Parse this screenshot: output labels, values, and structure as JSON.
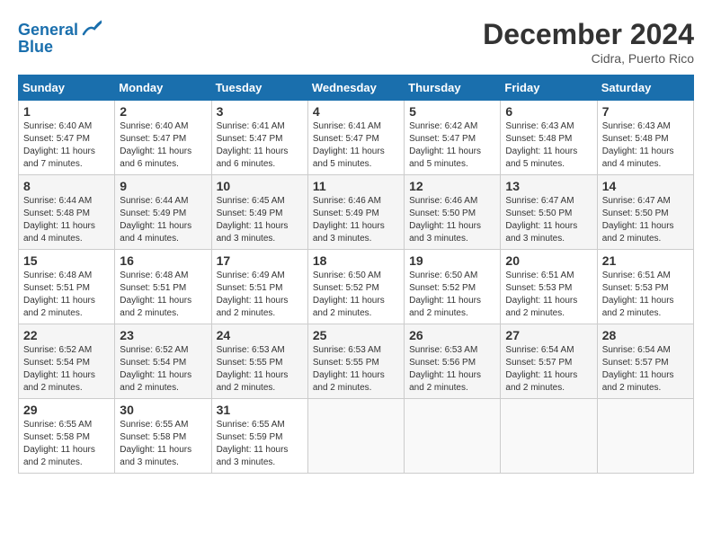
{
  "header": {
    "logo_line1": "General",
    "logo_line2": "Blue",
    "month": "December 2024",
    "location": "Cidra, Puerto Rico"
  },
  "days_of_week": [
    "Sunday",
    "Monday",
    "Tuesday",
    "Wednesday",
    "Thursday",
    "Friday",
    "Saturday"
  ],
  "weeks": [
    [
      {
        "day": "1",
        "sunrise": "Sunrise: 6:40 AM",
        "sunset": "Sunset: 5:47 PM",
        "daylight": "Daylight: 11 hours and 7 minutes."
      },
      {
        "day": "2",
        "sunrise": "Sunrise: 6:40 AM",
        "sunset": "Sunset: 5:47 PM",
        "daylight": "Daylight: 11 hours and 6 minutes."
      },
      {
        "day": "3",
        "sunrise": "Sunrise: 6:41 AM",
        "sunset": "Sunset: 5:47 PM",
        "daylight": "Daylight: 11 hours and 6 minutes."
      },
      {
        "day": "4",
        "sunrise": "Sunrise: 6:41 AM",
        "sunset": "Sunset: 5:47 PM",
        "daylight": "Daylight: 11 hours and 5 minutes."
      },
      {
        "day": "5",
        "sunrise": "Sunrise: 6:42 AM",
        "sunset": "Sunset: 5:47 PM",
        "daylight": "Daylight: 11 hours and 5 minutes."
      },
      {
        "day": "6",
        "sunrise": "Sunrise: 6:43 AM",
        "sunset": "Sunset: 5:48 PM",
        "daylight": "Daylight: 11 hours and 5 minutes."
      },
      {
        "day": "7",
        "sunrise": "Sunrise: 6:43 AM",
        "sunset": "Sunset: 5:48 PM",
        "daylight": "Daylight: 11 hours and 4 minutes."
      }
    ],
    [
      {
        "day": "8",
        "sunrise": "Sunrise: 6:44 AM",
        "sunset": "Sunset: 5:48 PM",
        "daylight": "Daylight: 11 hours and 4 minutes."
      },
      {
        "day": "9",
        "sunrise": "Sunrise: 6:44 AM",
        "sunset": "Sunset: 5:49 PM",
        "daylight": "Daylight: 11 hours and 4 minutes."
      },
      {
        "day": "10",
        "sunrise": "Sunrise: 6:45 AM",
        "sunset": "Sunset: 5:49 PM",
        "daylight": "Daylight: 11 hours and 3 minutes."
      },
      {
        "day": "11",
        "sunrise": "Sunrise: 6:46 AM",
        "sunset": "Sunset: 5:49 PM",
        "daylight": "Daylight: 11 hours and 3 minutes."
      },
      {
        "day": "12",
        "sunrise": "Sunrise: 6:46 AM",
        "sunset": "Sunset: 5:50 PM",
        "daylight": "Daylight: 11 hours and 3 minutes."
      },
      {
        "day": "13",
        "sunrise": "Sunrise: 6:47 AM",
        "sunset": "Sunset: 5:50 PM",
        "daylight": "Daylight: 11 hours and 3 minutes."
      },
      {
        "day": "14",
        "sunrise": "Sunrise: 6:47 AM",
        "sunset": "Sunset: 5:50 PM",
        "daylight": "Daylight: 11 hours and 2 minutes."
      }
    ],
    [
      {
        "day": "15",
        "sunrise": "Sunrise: 6:48 AM",
        "sunset": "Sunset: 5:51 PM",
        "daylight": "Daylight: 11 hours and 2 minutes."
      },
      {
        "day": "16",
        "sunrise": "Sunrise: 6:48 AM",
        "sunset": "Sunset: 5:51 PM",
        "daylight": "Daylight: 11 hours and 2 minutes."
      },
      {
        "day": "17",
        "sunrise": "Sunrise: 6:49 AM",
        "sunset": "Sunset: 5:51 PM",
        "daylight": "Daylight: 11 hours and 2 minutes."
      },
      {
        "day": "18",
        "sunrise": "Sunrise: 6:50 AM",
        "sunset": "Sunset: 5:52 PM",
        "daylight": "Daylight: 11 hours and 2 minutes."
      },
      {
        "day": "19",
        "sunrise": "Sunrise: 6:50 AM",
        "sunset": "Sunset: 5:52 PM",
        "daylight": "Daylight: 11 hours and 2 minutes."
      },
      {
        "day": "20",
        "sunrise": "Sunrise: 6:51 AM",
        "sunset": "Sunset: 5:53 PM",
        "daylight": "Daylight: 11 hours and 2 minutes."
      },
      {
        "day": "21",
        "sunrise": "Sunrise: 6:51 AM",
        "sunset": "Sunset: 5:53 PM",
        "daylight": "Daylight: 11 hours and 2 minutes."
      }
    ],
    [
      {
        "day": "22",
        "sunrise": "Sunrise: 6:52 AM",
        "sunset": "Sunset: 5:54 PM",
        "daylight": "Daylight: 11 hours and 2 minutes."
      },
      {
        "day": "23",
        "sunrise": "Sunrise: 6:52 AM",
        "sunset": "Sunset: 5:54 PM",
        "daylight": "Daylight: 11 hours and 2 minutes."
      },
      {
        "day": "24",
        "sunrise": "Sunrise: 6:53 AM",
        "sunset": "Sunset: 5:55 PM",
        "daylight": "Daylight: 11 hours and 2 minutes."
      },
      {
        "day": "25",
        "sunrise": "Sunrise: 6:53 AM",
        "sunset": "Sunset: 5:55 PM",
        "daylight": "Daylight: 11 hours and 2 minutes."
      },
      {
        "day": "26",
        "sunrise": "Sunrise: 6:53 AM",
        "sunset": "Sunset: 5:56 PM",
        "daylight": "Daylight: 11 hours and 2 minutes."
      },
      {
        "day": "27",
        "sunrise": "Sunrise: 6:54 AM",
        "sunset": "Sunset: 5:57 PM",
        "daylight": "Daylight: 11 hours and 2 minutes."
      },
      {
        "day": "28",
        "sunrise": "Sunrise: 6:54 AM",
        "sunset": "Sunset: 5:57 PM",
        "daylight": "Daylight: 11 hours and 2 minutes."
      }
    ],
    [
      {
        "day": "29",
        "sunrise": "Sunrise: 6:55 AM",
        "sunset": "Sunset: 5:58 PM",
        "daylight": "Daylight: 11 hours and 2 minutes."
      },
      {
        "day": "30",
        "sunrise": "Sunrise: 6:55 AM",
        "sunset": "Sunset: 5:58 PM",
        "daylight": "Daylight: 11 hours and 3 minutes."
      },
      {
        "day": "31",
        "sunrise": "Sunrise: 6:55 AM",
        "sunset": "Sunset: 5:59 PM",
        "daylight": "Daylight: 11 hours and 3 minutes."
      },
      null,
      null,
      null,
      null
    ]
  ]
}
